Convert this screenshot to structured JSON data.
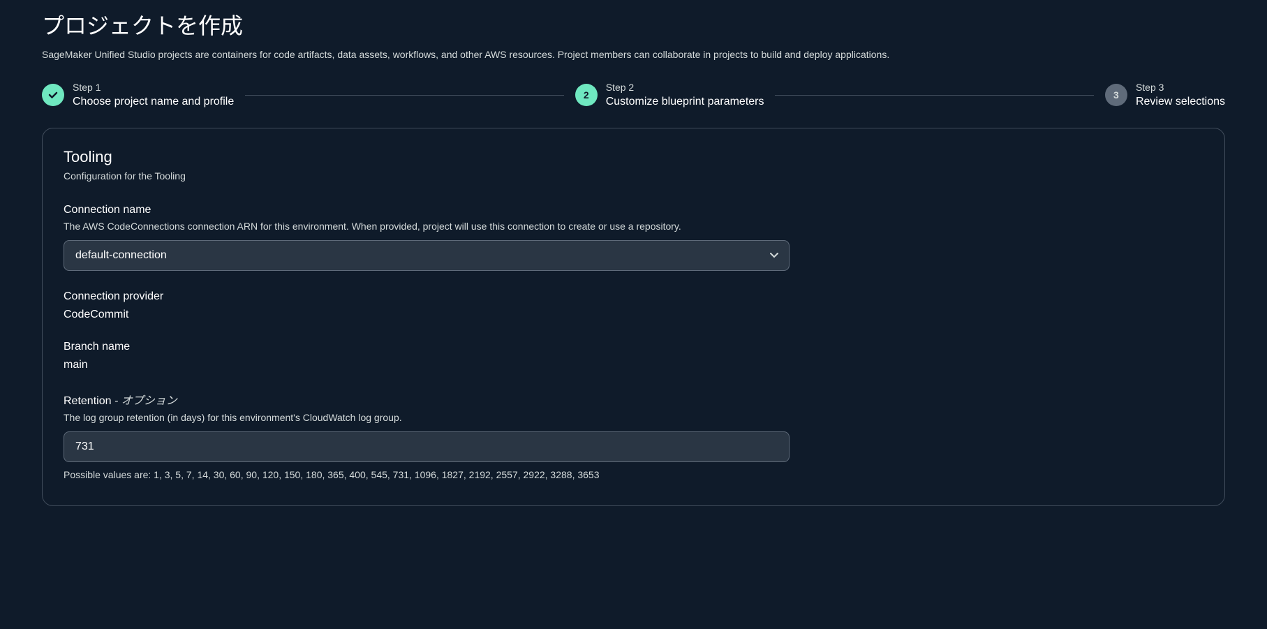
{
  "page": {
    "title": "プロジェクトを作成",
    "description": "SageMaker Unified Studio projects are containers for code artifacts, data assets, workflows, and other AWS resources. Project members can collaborate in projects to build and deploy applications."
  },
  "stepper": {
    "steps": [
      {
        "label": "Step 1",
        "title": "Choose project name and profile",
        "status": "completed"
      },
      {
        "label": "Step 2",
        "title": "Customize blueprint parameters",
        "status": "active",
        "number": "2"
      },
      {
        "label": "Step 3",
        "title": "Review selections",
        "status": "pending",
        "number": "3"
      }
    ]
  },
  "section": {
    "title": "Tooling",
    "description": "Configuration for the Tooling"
  },
  "fields": {
    "connectionName": {
      "label": "Connection name",
      "description": "The AWS CodeConnections connection ARN for this environment. When provided, project will use this connection to create or use a repository.",
      "value": "default-connection"
    },
    "connectionProvider": {
      "label": "Connection provider",
      "value": "CodeCommit"
    },
    "branchName": {
      "label": "Branch name",
      "value": "main"
    },
    "retention": {
      "label": "Retention",
      "optionalTag": " - オプション",
      "description": "The log group retention (in days) for this environment's CloudWatch log group.",
      "value": "731",
      "helper": "Possible values are: 1, 3, 5, 7, 14, 30, 60, 90, 120, 150, 180, 365, 400, 545, 731, 1096, 1827, 2192, 2557, 2922, 3288, 3653"
    }
  }
}
